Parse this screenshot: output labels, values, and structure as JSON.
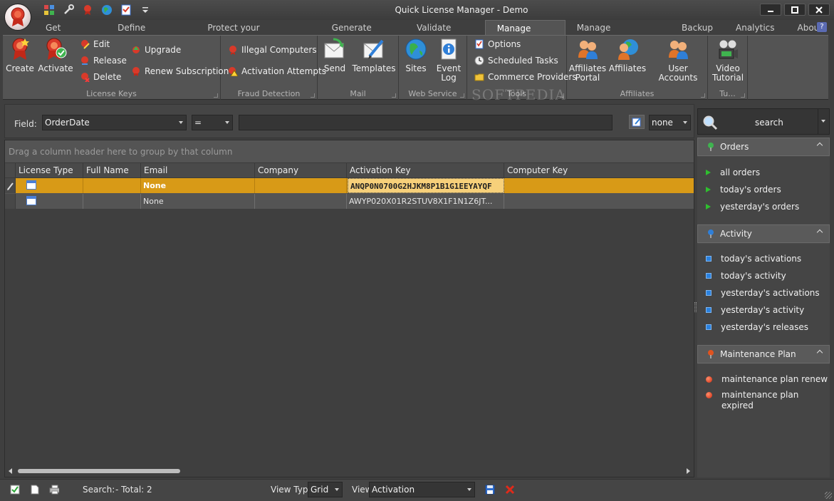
{
  "window": {
    "title": "Quick License Manager - Demo"
  },
  "tabs": [
    {
      "label": "Get Started"
    },
    {
      "label": "Define Products"
    },
    {
      "label": "Protect your application"
    },
    {
      "label": "Generate Keys"
    },
    {
      "label": "Validate Keys"
    },
    {
      "label": "Manage Keys",
      "active": true
    },
    {
      "label": "Manage Customers"
    },
    {
      "label": "Backup"
    },
    {
      "label": "Analytics"
    },
    {
      "label": "About"
    }
  ],
  "help_label": "?",
  "ribbon": {
    "license_keys": {
      "label": "License Keys",
      "create": "Create",
      "activate": "Activate",
      "edit": "Edit",
      "release": "Release",
      "delete": "Delete",
      "upgrade": "Upgrade",
      "renew": "Renew Subscription"
    },
    "fraud": {
      "label": "Fraud Detection",
      "illegal": "Illegal Computers",
      "attempts": "Activation Attempts"
    },
    "mail": {
      "label": "Mail",
      "send": "Send",
      "templates": "Templates"
    },
    "web": {
      "label": "Web Service",
      "sites": "Sites",
      "event_log_1": "Event",
      "event_log_2": "Log"
    },
    "tools": {
      "label": "Tools",
      "options": "Options",
      "scheduled": "Scheduled Tasks",
      "commerce": "Commerce Providers"
    },
    "affiliates": {
      "label": "Affiliates",
      "portal_1": "Affiliates",
      "portal_2": "Portal",
      "affiliates": "Affiliates",
      "user_accounts": "User Accounts"
    },
    "video": {
      "label": "Tu...",
      "video_1": "Video",
      "video_2": "Tutorial"
    },
    "watermark": "SOFTPEDIA"
  },
  "filter": {
    "field_label": "Field:",
    "field_value": "OrderDate",
    "operator": "=",
    "value": "",
    "none_value": "none"
  },
  "search": {
    "label": "search"
  },
  "grid": {
    "group_hint": "Drag a column header here to group by that column",
    "columns": [
      "License Type",
      "Full Name",
      "Email",
      "Company",
      "Activation Key",
      "Computer Key"
    ],
    "rows": [
      {
        "license_type": "",
        "full_name": "",
        "email": "None",
        "company": "",
        "activation_key": "ANQP0N0700G2HJKM8P1B1G1EEYAYQF",
        "computer_key": ""
      },
      {
        "license_type": "",
        "full_name": "",
        "email": "None",
        "company": "",
        "activation_key": "AWYP020X01R2STUV8X1F1N1Z6JT...",
        "computer_key": ""
      }
    ]
  },
  "side": {
    "orders": {
      "title": "Orders",
      "items": [
        "all orders",
        "today's orders",
        "yesterday's orders"
      ]
    },
    "activity": {
      "title": "Activity",
      "items": [
        "today's activations",
        "today's activity",
        "yesterday's activations",
        "yesterday's activity",
        "yesterday's releases"
      ]
    },
    "maintenance": {
      "title": "Maintenance Plan",
      "items": [
        "maintenance plan renew",
        "maintenance plan expired"
      ]
    }
  },
  "status": {
    "search_label": "Search:",
    "total": "- Total: 2",
    "view_type_label": "View Type",
    "view_type_value": "Grid",
    "view_label": "View",
    "view_value": "Activation"
  }
}
